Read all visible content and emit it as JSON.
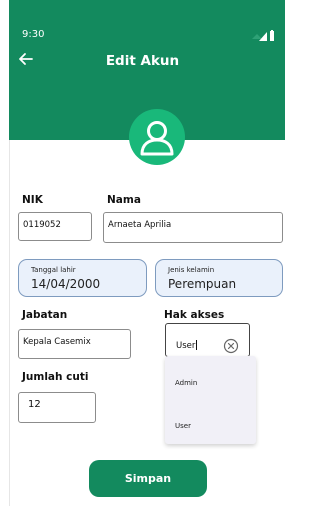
{
  "status": {
    "time": "9:30"
  },
  "header": {
    "title": "Edit Akun"
  },
  "fields": {
    "nik": {
      "label": "NIK",
      "value": "0119052"
    },
    "nama": {
      "label": "Nama",
      "value": "Arnaeta Aprilia"
    },
    "tanggal_lahir": {
      "label": "Tanggal lahir",
      "value": "14/04/2000"
    },
    "jenis_kelamin": {
      "label": "Jenis kelamin",
      "value": "Perempuan"
    },
    "jabatan": {
      "label": "Jabatan",
      "value": "Kepala Casemix"
    },
    "hak_akses": {
      "label": "Hak akses",
      "value": "User"
    },
    "jumlah_cuti": {
      "label": "Jumlah cuti",
      "value": "12"
    }
  },
  "dropdown": {
    "options": [
      "Admin",
      "User"
    ]
  },
  "actions": {
    "save_label": "Simpan"
  },
  "colors": {
    "primary": "#138a5e",
    "avatar_bg": "#19b87a",
    "pill_bg": "#eaf1fb",
    "pill_border": "#7e9bbf",
    "dropdown_bg": "#f1f0f7"
  },
  "icons": {
    "back": "arrow-left-icon",
    "avatar": "user-icon",
    "clear": "clear-circle-icon",
    "signal": "signal-icon",
    "battery": "battery-icon"
  }
}
